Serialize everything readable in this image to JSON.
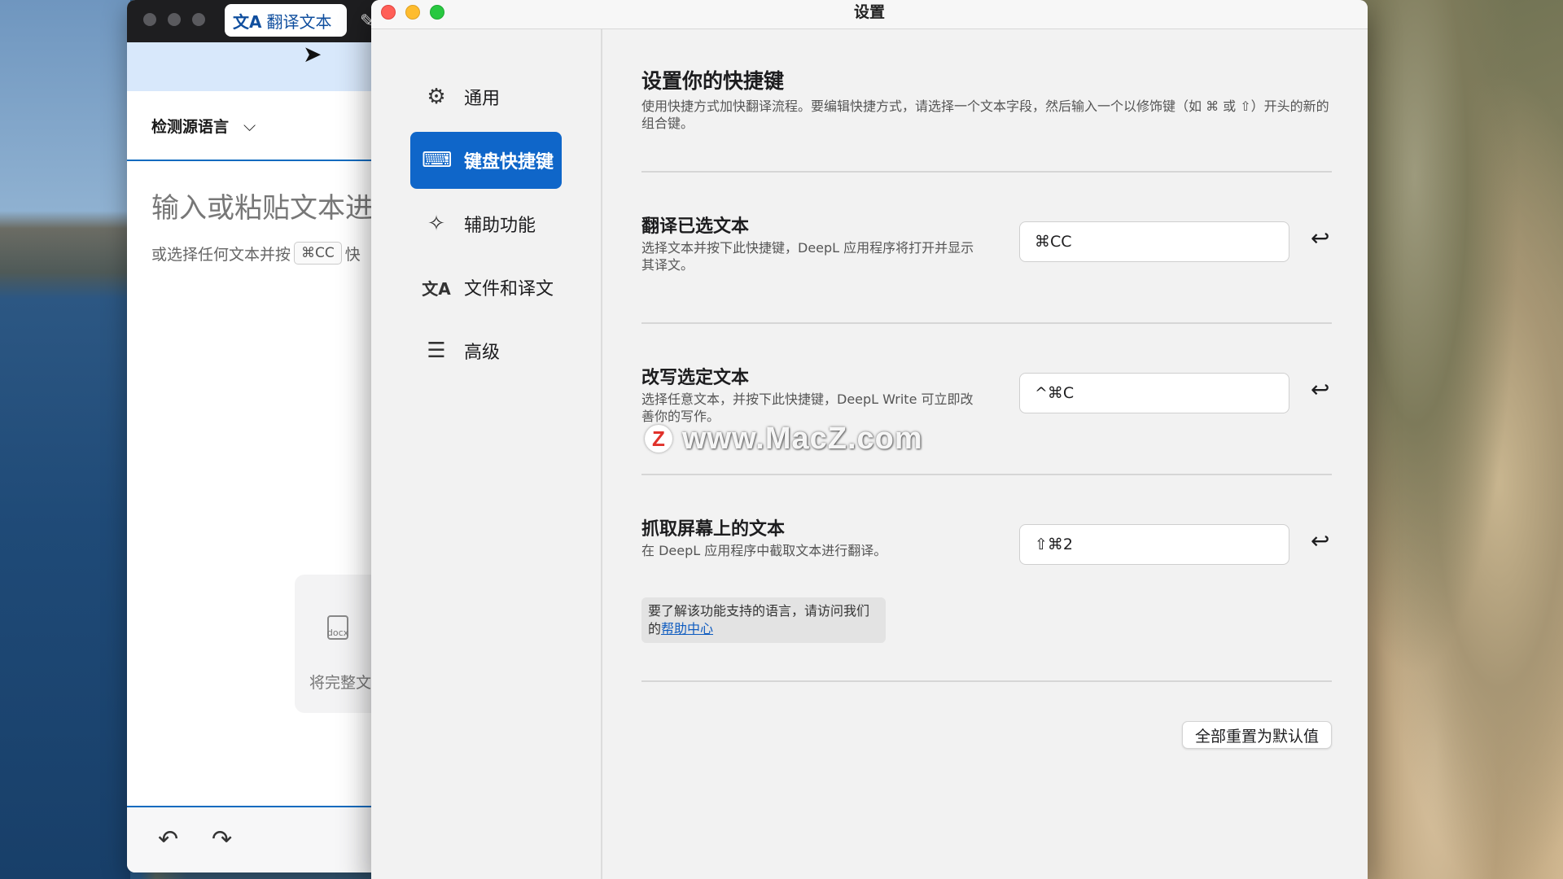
{
  "deepl_window": {
    "tab_label": "翻译文本",
    "source_language": "检测源语言",
    "placeholder_big": "输入或粘贴文本进",
    "placeholder_small_prefix": "或选择任何文本并按",
    "placeholder_shortcut": "⌘CC",
    "placeholder_small_suffix": "快",
    "doc_drop_text": "将完整文",
    "doc_icon_label": "docx"
  },
  "settings": {
    "window_title": "设置",
    "sidebar": {
      "items": [
        {
          "label": "通用",
          "icon": "gear-icon"
        },
        {
          "label": "键盘快捷键",
          "icon": "keyboard-icon"
        },
        {
          "label": "辅助功能",
          "icon": "accessibility-icon"
        },
        {
          "label": "文件和译文",
          "icon": "translate-icon"
        },
        {
          "label": "高级",
          "icon": "sliders-icon"
        }
      ],
      "active_index": 1
    },
    "main": {
      "title": "设置你的快捷键",
      "description": "使用快捷方式加快翻译流程。要编辑快捷方式，请选择一个文本字段，然后输入一个以修饰键（如 ⌘ 或 ⇧）开头的新的组合键。",
      "shortcuts": [
        {
          "title": "翻译已选文本",
          "description": "选择文本并按下此快捷键，DeepL 应用程序将打开并显示其译文。",
          "value": "⌘CC"
        },
        {
          "title": "改写选定文本",
          "description": "选择任意文本，并按下此快捷键，DeepL Write 可立即改善你的写作。",
          "value": "^⌘C"
        },
        {
          "title": "抓取屏幕上的文本",
          "description": "在 DeepL 应用程序中截取文本进行翻译。",
          "value": "⇧⌘2"
        }
      ],
      "note_text": "要了解该功能支持的语言，请访问我们的",
      "note_link": "帮助中心",
      "reset_all_label": "全部重置为默认值"
    }
  },
  "watermark": {
    "logo": "Z",
    "text": "www.MacZ.com"
  },
  "colors": {
    "accent": "#0f66c9",
    "link": "#0f5cc0",
    "deepl_blue": "#0f6bbf"
  }
}
